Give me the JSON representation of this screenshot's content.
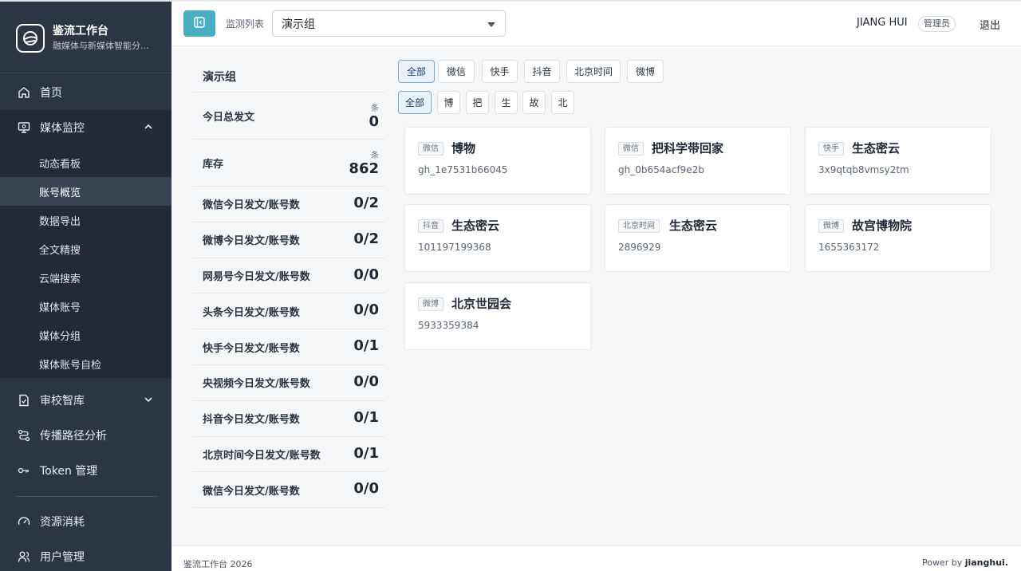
{
  "brand": {
    "title": "鉴流工作台",
    "subtitle": "融媒体与新媒体智能分..."
  },
  "nav": {
    "home": "首页",
    "media_monitor": "媒体监控",
    "sub_items": [
      "动态看板",
      "账号概览",
      "数据导出",
      "全文精搜",
      "云端搜索",
      "媒体账号",
      "媒体分组",
      "媒体账号自检"
    ],
    "review_library": "审校智库",
    "propagation": "传播路径分析",
    "token": "Token 管理",
    "resources": "资源消耗",
    "users": "用户管理"
  },
  "header": {
    "watch_label": "监测列表",
    "selected_group": "演示组",
    "user_name": "JIANG HUI",
    "role": "管理员",
    "logout": "退出"
  },
  "stats": {
    "group_title": "演示组",
    "today_total_label": "今日总发文",
    "today_total_unit": "条",
    "today_total_value": "0",
    "stock_label": "库存",
    "stock_unit": "条",
    "stock_value": "862",
    "rows": [
      {
        "label": "微信今日发文/账号数",
        "value": "0/2"
      },
      {
        "label": "微博今日发文/账号数",
        "value": "0/2"
      },
      {
        "label": "网易号今日发文/账号数",
        "value": "0/0"
      },
      {
        "label": "头条今日发文/账号数",
        "value": "0/0"
      },
      {
        "label": "快手今日发文/账号数",
        "value": "0/1"
      },
      {
        "label": "央视频今日发文/账号数",
        "value": "0/0"
      },
      {
        "label": "抖音今日发文/账号数",
        "value": "0/1"
      },
      {
        "label": "北京时间今日发文/账号数",
        "value": "0/1"
      },
      {
        "label": "微信今日发文/账号数",
        "value": "0/0"
      }
    ]
  },
  "platform_filters": [
    "全部",
    "微信",
    "快手",
    "抖音",
    "北京时间",
    "微博"
  ],
  "initial_filters": [
    "全部",
    "博",
    "把",
    "生",
    "故",
    "北"
  ],
  "cards": [
    {
      "tag": "微信",
      "name": "博物",
      "id": "gh_1e7531b66045"
    },
    {
      "tag": "微信",
      "name": "把科学带回家",
      "id": "gh_0b654acf9e2b"
    },
    {
      "tag": "快手",
      "name": "生态密云",
      "id": "3x9qtqb8vmsy2tm"
    },
    {
      "tag": "抖音",
      "name": "生态密云",
      "id": "101197199368"
    },
    {
      "tag": "北京时间",
      "name": "生态密云",
      "id": "2896929"
    },
    {
      "tag": "微博",
      "name": "故宫博物院",
      "id": "1655363172"
    },
    {
      "tag": "微博",
      "name": "北京世园会",
      "id": "5933359384"
    }
  ],
  "footer": {
    "left": "鉴流工作台 2026",
    "right_prefix": "Power by ",
    "right_brand": "jianghui."
  }
}
